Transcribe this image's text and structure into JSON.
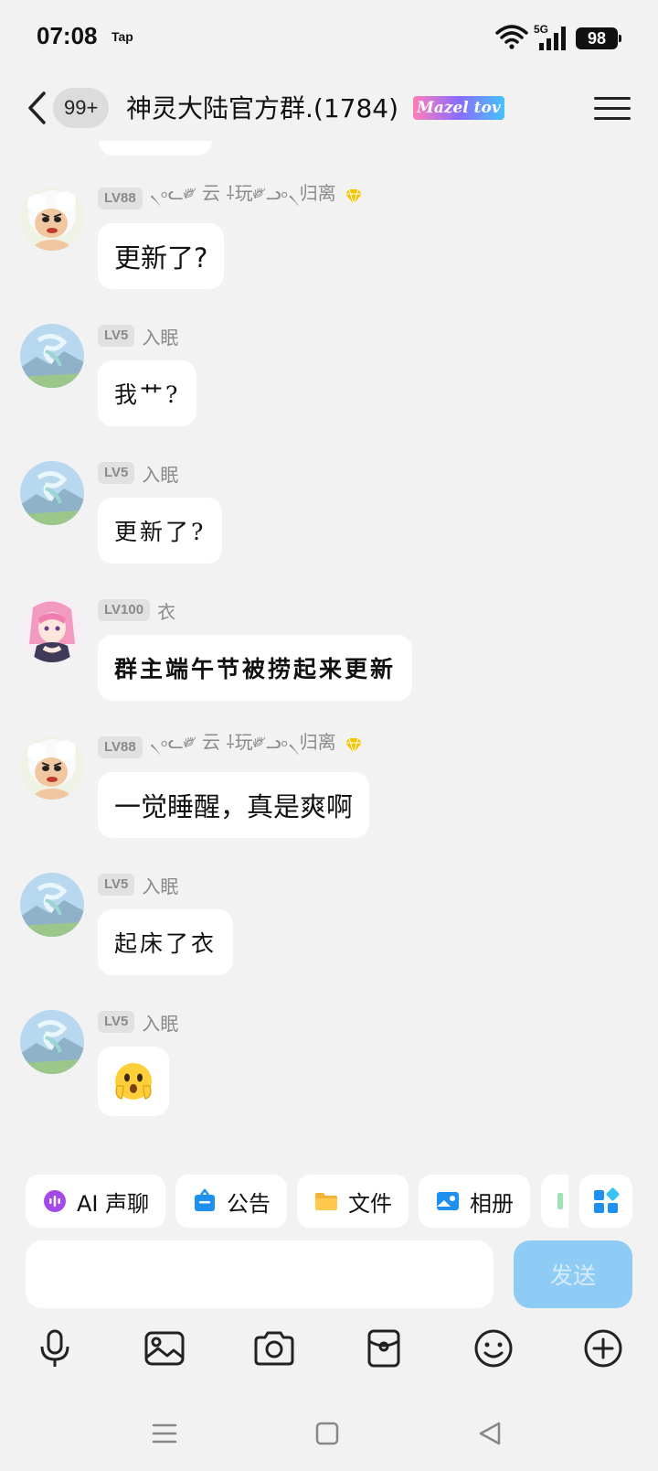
{
  "status_bar": {
    "time": "07:08",
    "carrier_tag": "Tap",
    "network": "5G",
    "battery": "98"
  },
  "header": {
    "unread_count": "99+",
    "title": "神灵大陆官方群.(1784)",
    "tag": "Mazel tov"
  },
  "messages": [
    {
      "level": "LV88",
      "nickname": "৲৹ᓚ༗ 云 ⸸玩༗ᓗ৹৲归离",
      "text": "更新了?",
      "avatar": "cartoon-sheep-avatar"
    },
    {
      "level": "LV5",
      "nickname": "入眠",
      "text": "我艹?",
      "avatar": "landscape-dragon-avatar"
    },
    {
      "level": "LV5",
      "nickname": "入眠",
      "text": "更新了?",
      "avatar": "landscape-dragon-avatar"
    },
    {
      "level": "LV100",
      "nickname": "衣",
      "text": "群主端午节被捞起来更新",
      "avatar": "anime-girl-avatar"
    },
    {
      "level": "LV88",
      "nickname": "৲৹ᓚ༗ 云 ⸸玩༗ᓗ৹৲归离",
      "text": "一觉睡醒，真是爽啊",
      "avatar": "cartoon-sheep-avatar"
    },
    {
      "level": "LV5",
      "nickname": "入眠",
      "text": "起床了衣",
      "avatar": "landscape-dragon-avatar"
    },
    {
      "level": "LV5",
      "nickname": "入眠",
      "text": "",
      "avatar": "landscape-dragon-avatar",
      "emoji": "shocked-face-emoji"
    }
  ],
  "quick_actions": [
    {
      "label": "AI 声聊",
      "icon": "ai-voice-icon",
      "color": "#a349e8"
    },
    {
      "label": "公告",
      "icon": "announcement-icon",
      "color": "#1f8ff0"
    },
    {
      "label": "文件",
      "icon": "folder-icon",
      "color": "#f5b335"
    },
    {
      "label": "相册",
      "icon": "album-icon",
      "color": "#1f8ff0"
    }
  ],
  "composer": {
    "placeholder": "",
    "send_label": "发送"
  },
  "toolbar": [
    "microphone-icon",
    "image-icon",
    "camera-icon",
    "red-packet-icon",
    "emoji-icon",
    "plus-icon"
  ],
  "colors": {
    "background": "#f2f2f2",
    "bubble": "#ffffff",
    "send_button": "#8ecbf5",
    "level_badge": "#e1e1e1"
  }
}
